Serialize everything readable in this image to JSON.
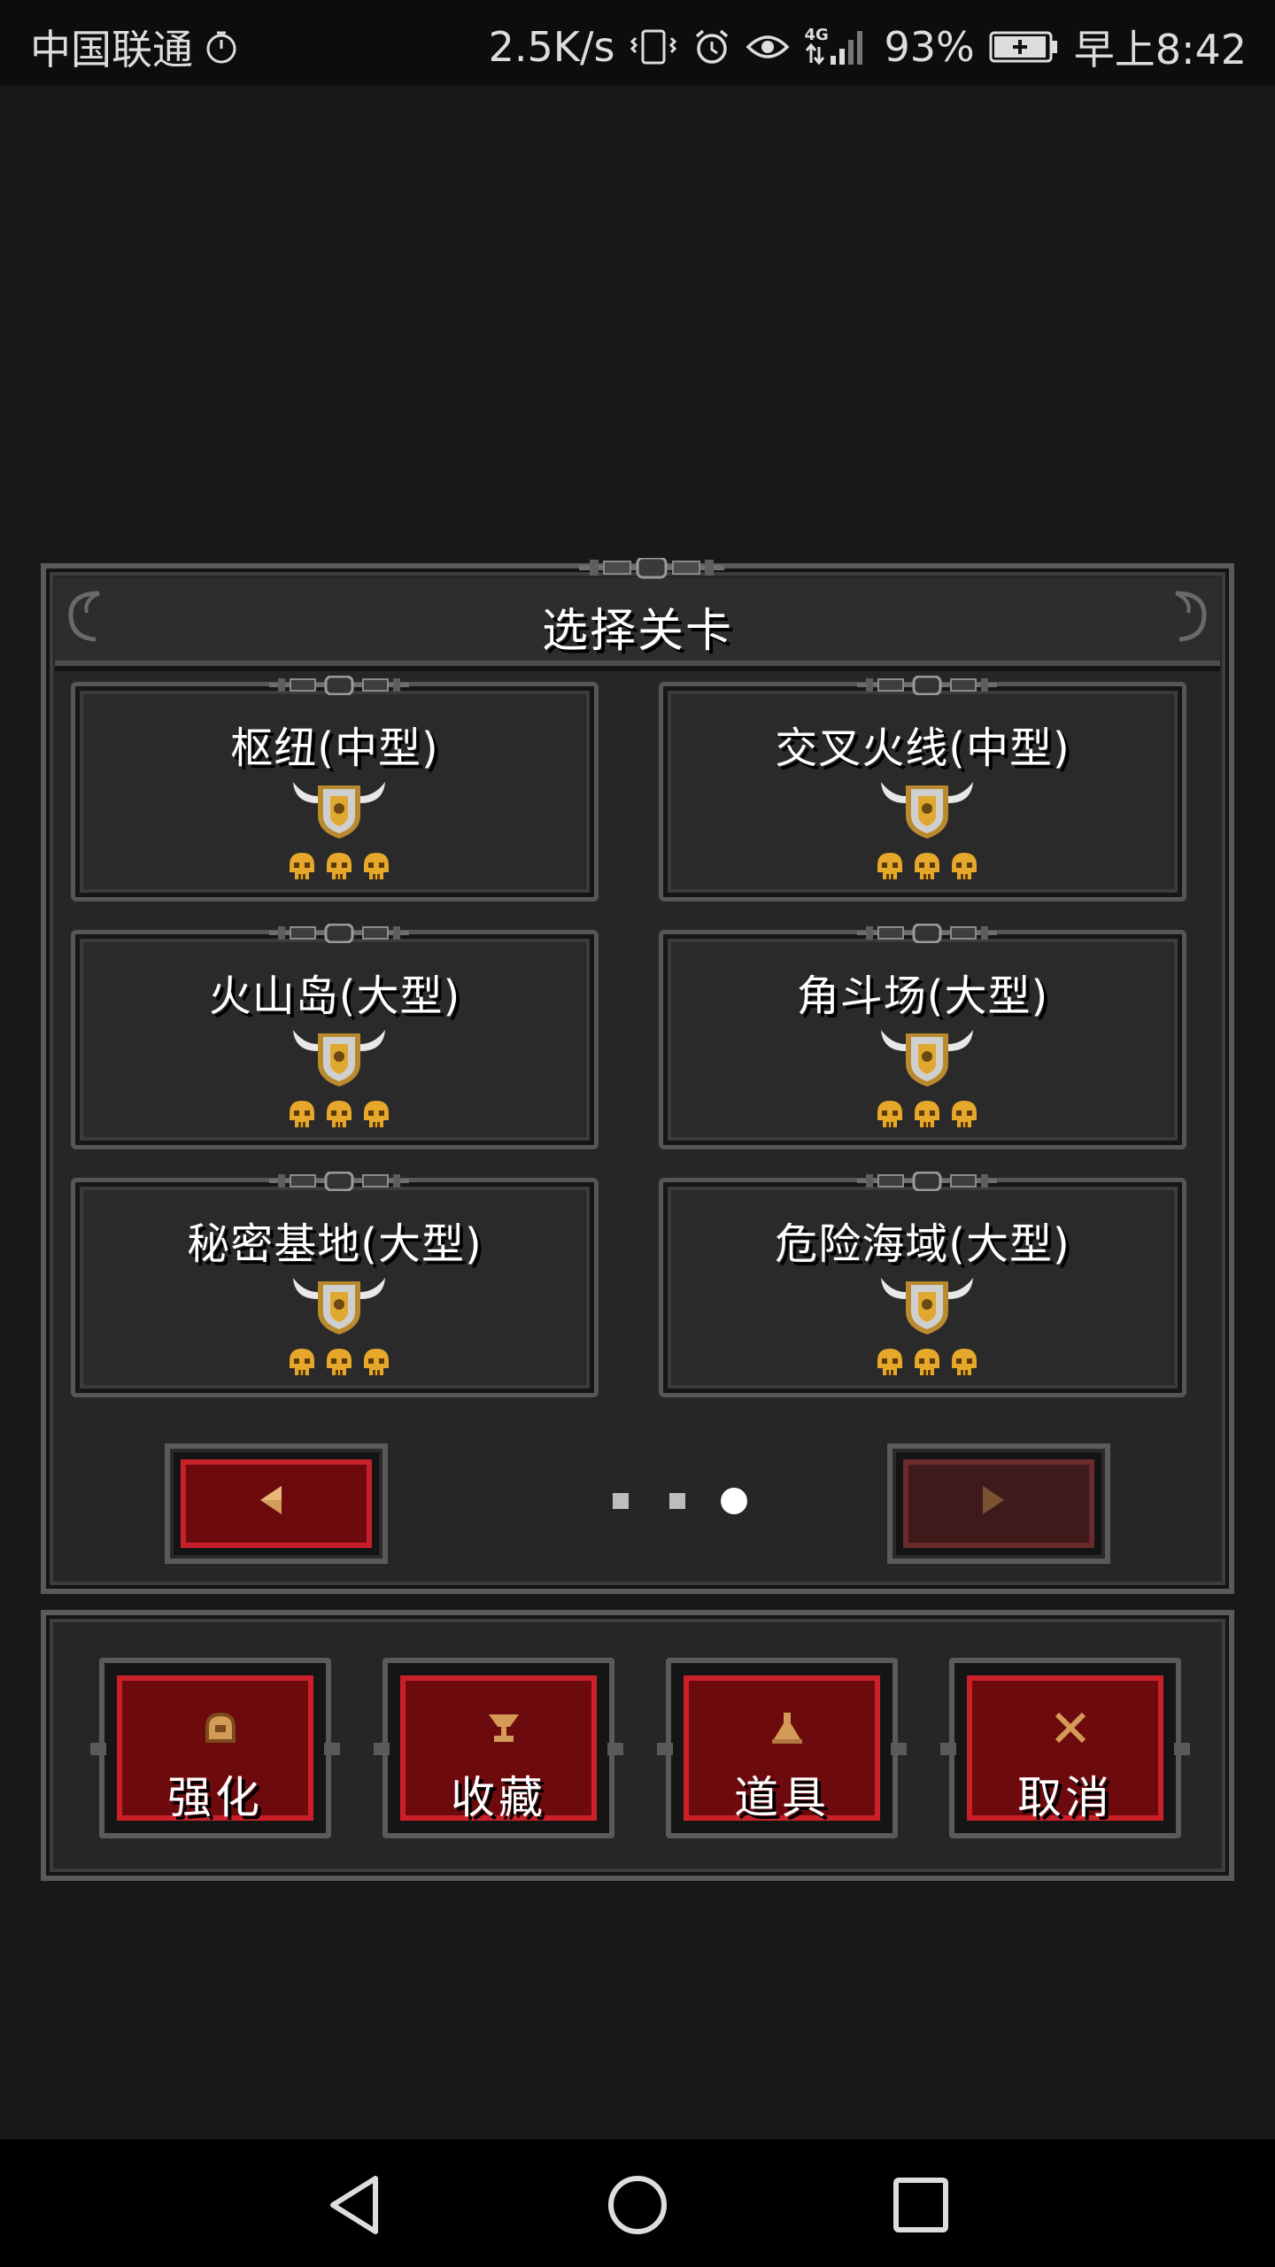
{
  "status_bar": {
    "carrier": "中国联通",
    "net_speed": "2.5K/s",
    "battery_percent": "93%",
    "time": "早上8:42",
    "network_type": "4G",
    "icons": [
      "timer-icon",
      "vibrate-icon",
      "alarm-icon",
      "eye-icon",
      "signal-icon",
      "battery-icon"
    ]
  },
  "panel": {
    "title": "选择关卡"
  },
  "levels": [
    {
      "name": "枢纽(中型)",
      "skulls": 3
    },
    {
      "name": "交叉火线(中型)",
      "skulls": 3
    },
    {
      "name": "火山岛(大型)",
      "skulls": 3
    },
    {
      "name": "角斗场(大型)",
      "skulls": 3
    },
    {
      "name": "秘密基地(大型)",
      "skulls": 3
    },
    {
      "name": "危险海域(大型)",
      "skulls": 3
    }
  ],
  "pagination": {
    "total_pages": 3,
    "current_page": 3,
    "prev_enabled": true,
    "next_enabled": false
  },
  "actions": [
    {
      "label": "强化",
      "icon": "upgrade-icon"
    },
    {
      "label": "收藏",
      "icon": "trophy-icon"
    },
    {
      "label": "道具",
      "icon": "potion-icon"
    },
    {
      "label": "取消",
      "icon": "cross-icon"
    }
  ],
  "colors": {
    "button_red": "#6d0a0e",
    "button_red_border": "#cc2029",
    "skull_gold": "#e6a82a",
    "panel_bg": "#262626"
  }
}
